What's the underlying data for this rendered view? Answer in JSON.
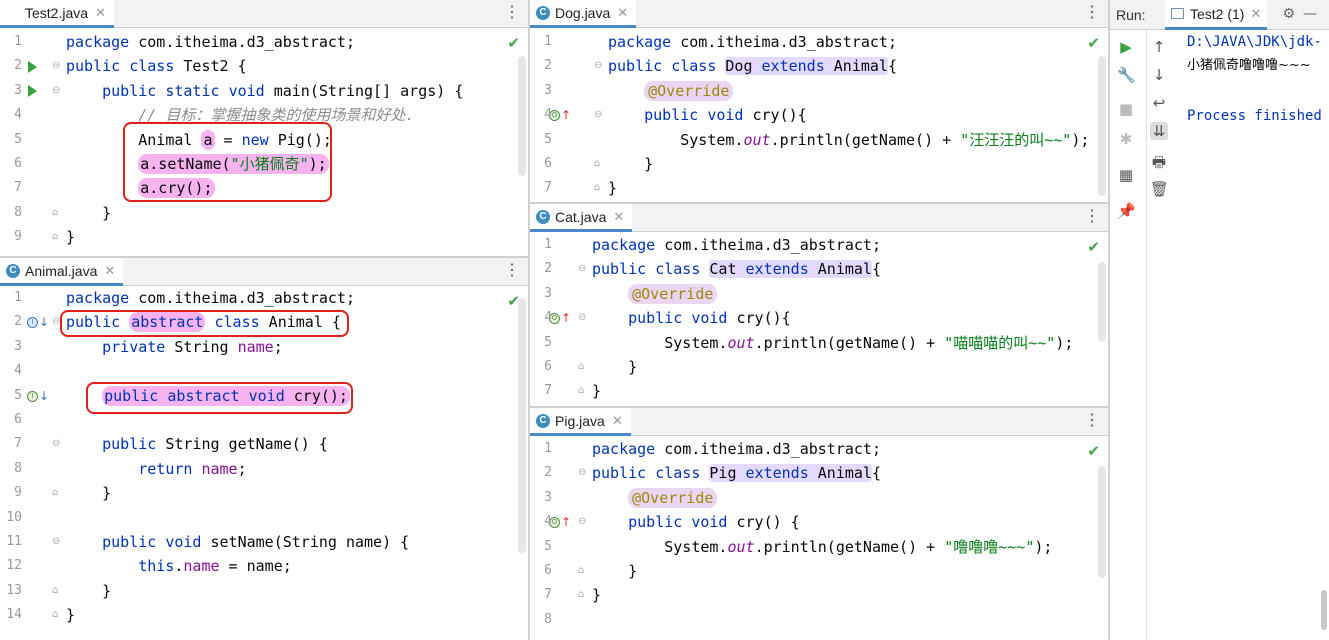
{
  "editors": {
    "test2": {
      "tab": "Test2.java",
      "lines": [
        "package com.itheima.d3_abstract;",
        "public class Test2 {",
        "    public static void main(String[] args) {",
        "        // 目标：掌握抽象类的使用场景和好处.",
        "        Animal a = new Pig();",
        "        a.setName(\"小猪佩奇\");",
        "        a.cry();",
        "    }",
        "}"
      ]
    },
    "animal": {
      "tab": "Animal.java",
      "lines": [
        "package com.itheima.d3_abstract;",
        "public abstract class Animal {",
        "    private String name;",
        "",
        "    public abstract void cry();",
        "",
        "    public String getName() {",
        "        return name;",
        "    }",
        "",
        "    public void setName(String name) {",
        "        this.name = name;",
        "    }",
        "}"
      ]
    },
    "dog": {
      "tab": "Dog.java",
      "lines": [
        "package com.itheima.d3_abstract;",
        "public class Dog extends Animal{",
        "    @Override",
        "    public void cry(){",
        "        System.out.println(getName() + \"汪汪汪的叫~~\");",
        "    }",
        "}"
      ]
    },
    "cat": {
      "tab": "Cat.java",
      "lines": [
        "package com.itheima.d3_abstract;",
        "public class Cat extends Animal{",
        "    @Override",
        "    public void cry(){",
        "        System.out.println(getName() + \"喵喵喵的叫~~\");",
        "    }",
        "}"
      ]
    },
    "pig": {
      "tab": "Pig.java",
      "lines": [
        "package com.itheima.d3_abstract;",
        "public class Pig extends Animal{",
        "    @Override",
        "    public void cry() {",
        "        System.out.println(getName() + \"噜噜噜~~~\");",
        "    }",
        "}",
        ""
      ]
    }
  },
  "run": {
    "label": "Run:",
    "tab": "Test2 (1)",
    "console": [
      "D:\\JAVA\\JDK\\jdk-",
      "小猪佩奇噜噜噜~~~",
      "",
      "Process finished"
    ]
  },
  "colors": {
    "keyword": "#0033b3",
    "string": "#067d17",
    "highlight": "#f6b3f0",
    "redbox": "#e0201b",
    "tab_accent": "#4a88c7"
  },
  "icons": [
    "run-icon",
    "wrench-icon",
    "stop-icon",
    "rerun-icon",
    "layout-icon",
    "pin-icon",
    "up-arrow-icon",
    "down-arrow-icon",
    "soft-wrap-icon",
    "scroll-end-icon",
    "print-icon",
    "trash-icon",
    "gear-icon",
    "minimize-icon"
  ]
}
